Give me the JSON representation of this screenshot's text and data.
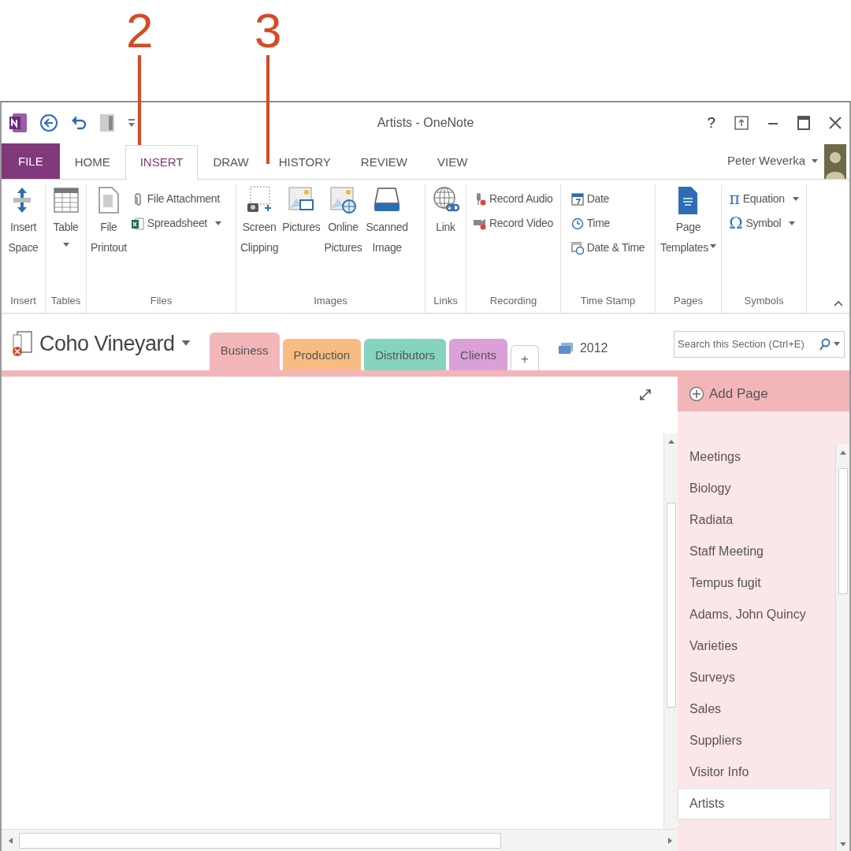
{
  "callouts": [
    {
      "label": "2"
    },
    {
      "label": "3"
    }
  ],
  "window": {
    "title": "Artists - OneNote",
    "help": "?"
  },
  "ribbon_tabs": [
    {
      "label": "FILE",
      "kind": "file",
      "selected": false
    },
    {
      "label": "HOME",
      "kind": "tab",
      "selected": false
    },
    {
      "label": "INSERT",
      "kind": "tab",
      "selected": true
    },
    {
      "label": "DRAW",
      "kind": "tab",
      "selected": false
    },
    {
      "label": "HISTORY",
      "kind": "tab",
      "selected": false
    },
    {
      "label": "REVIEW",
      "kind": "tab",
      "selected": false
    },
    {
      "label": "VIEW",
      "kind": "tab",
      "selected": false
    }
  ],
  "user": {
    "name": "Peter Weverka"
  },
  "ribbon_groups": [
    {
      "label": "Insert",
      "items": [
        {
          "kind": "large",
          "lines": [
            "Insert",
            "Space"
          ],
          "dropdown": false
        }
      ]
    },
    {
      "label": "Tables",
      "items": [
        {
          "kind": "large",
          "lines": [
            "Table"
          ],
          "dropdown": true
        }
      ]
    },
    {
      "label": "Files",
      "items": [
        {
          "kind": "large",
          "lines": [
            "File",
            "Printout"
          ],
          "dropdown": false
        },
        {
          "kind": "stack",
          "items": [
            {
              "label": "File Attachment",
              "dropdown": false
            },
            {
              "label": "Spreadsheet",
              "dropdown": true
            }
          ]
        }
      ]
    },
    {
      "label": "Images",
      "items": [
        {
          "kind": "large",
          "lines": [
            "Screen",
            "Clipping"
          ],
          "dropdown": false
        },
        {
          "kind": "large",
          "lines": [
            "Pictures"
          ],
          "dropdown": false
        },
        {
          "kind": "large",
          "lines": [
            "Online",
            "Pictures"
          ],
          "dropdown": false
        },
        {
          "kind": "large",
          "lines": [
            "Scanned",
            "Image"
          ],
          "dropdown": false
        }
      ]
    },
    {
      "label": "Links",
      "items": [
        {
          "kind": "large",
          "lines": [
            "Link"
          ],
          "dropdown": false
        }
      ]
    },
    {
      "label": "Recording",
      "items": [
        {
          "kind": "stack",
          "items": [
            {
              "label": "Record Audio",
              "dropdown": false
            },
            {
              "label": "Record Video",
              "dropdown": false
            }
          ]
        }
      ]
    },
    {
      "label": "Time Stamp",
      "items": [
        {
          "kind": "stack",
          "items": [
            {
              "label": "Date",
              "dropdown": false
            },
            {
              "label": "Time",
              "dropdown": false
            },
            {
              "label": "Date & Time",
              "dropdown": false
            }
          ]
        }
      ]
    },
    {
      "label": "Pages",
      "items": [
        {
          "kind": "large",
          "lines": [
            "Page",
            "Templates"
          ],
          "dropdown": true
        }
      ]
    },
    {
      "label": "Symbols",
      "items": [
        {
          "kind": "stack",
          "items": [
            {
              "label": "Equation",
              "symbol": "π",
              "dropdown": true
            },
            {
              "label": "Symbol",
              "symbol": "Ω",
              "dropdown": true
            }
          ]
        }
      ]
    }
  ],
  "notebook": {
    "name": "Coho Vineyard"
  },
  "sections": [
    {
      "label": "Business",
      "color": "#f2b6b9",
      "selected": true
    },
    {
      "label": "Production",
      "color": "#f6bc82",
      "selected": false
    },
    {
      "label": "Distributors",
      "color": "#86d3c0",
      "selected": false
    },
    {
      "label": "Clients",
      "color": "#dba0d8",
      "selected": false
    }
  ],
  "add_section": {
    "label": "+"
  },
  "section_group": {
    "label": "2012"
  },
  "search": {
    "placeholder": "Search this Section (Ctrl+E)"
  },
  "add_page": {
    "label": "Add Page"
  },
  "pages": [
    {
      "title": "Meetings",
      "selected": false
    },
    {
      "title": "Biology",
      "selected": false
    },
    {
      "title": "Radiata",
      "selected": false
    },
    {
      "title": "Staff Meeting",
      "selected": false
    },
    {
      "title": "Tempus fugit",
      "selected": false
    },
    {
      "title": "Adams, John Quincy",
      "selected": false
    },
    {
      "title": "Varieties",
      "selected": false
    },
    {
      "title": "Surveys",
      "selected": false
    },
    {
      "title": "Sales",
      "selected": false
    },
    {
      "title": "Suppliers",
      "selected": false
    },
    {
      "title": "Visitor Info",
      "selected": false
    },
    {
      "title": "Artists",
      "selected": true
    }
  ]
}
